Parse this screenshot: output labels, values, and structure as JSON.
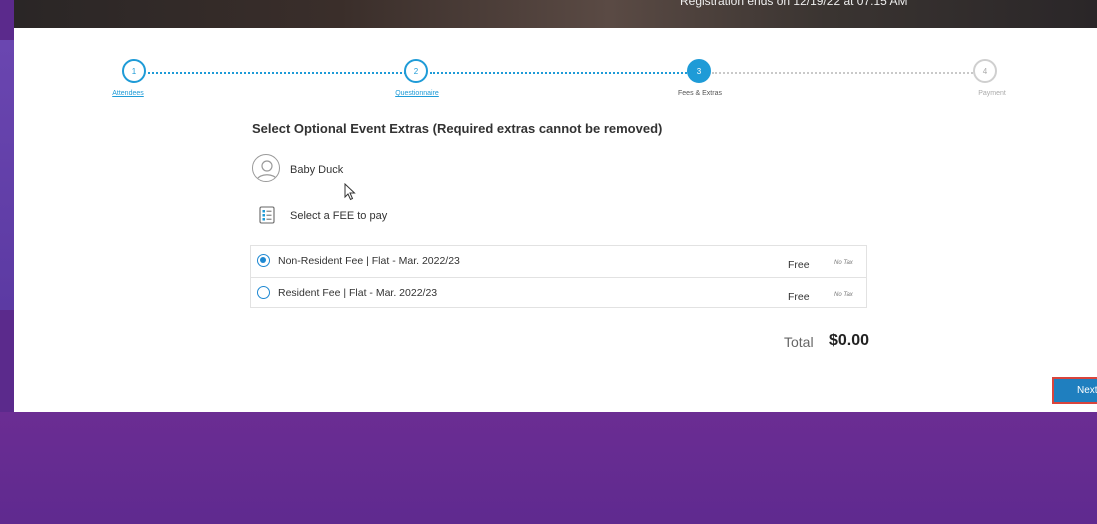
{
  "banner": {
    "text": "Registration ends on 12/19/22 at 07:15 AM"
  },
  "stepper": {
    "steps": [
      {
        "number": "1",
        "label": "Attendees"
      },
      {
        "number": "2",
        "label": "Questionnaire"
      },
      {
        "number": "3",
        "label": "Fees & Extras"
      },
      {
        "number": "4",
        "label": "Payment"
      }
    ],
    "current_step": 3
  },
  "main": {
    "heading": "Select Optional Event Extras (Required extras cannot be removed)",
    "attendee_name": "Baby Duck",
    "select_fee_label": "Select a FEE to pay",
    "fees": [
      {
        "name": "Non-Resident Fee | Flat - Mar. 2022/23",
        "price": "Free",
        "tax": "No Tax",
        "selected": true
      },
      {
        "name": "Resident Fee | Flat - Mar. 2022/23",
        "price": "Free",
        "tax": "No Tax",
        "selected": false
      }
    ],
    "total_label": "Total",
    "total_value": "$0.00"
  },
  "actions": {
    "next_label": "Next"
  },
  "colors": {
    "accent": "#1e9bd7",
    "page_bg": "#5b2a8c",
    "next_button": "#1f7fbf",
    "highlight": "#d9443c"
  }
}
